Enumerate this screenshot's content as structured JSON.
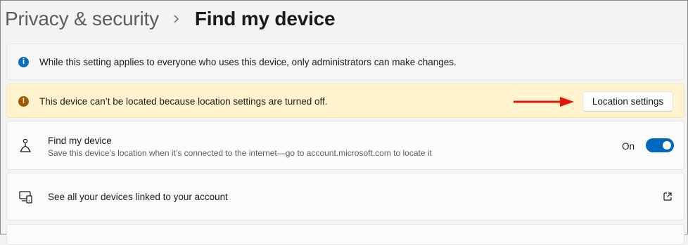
{
  "breadcrumb": {
    "parent": "Privacy & security",
    "separator_icon": "chevron-right-icon",
    "current": "Find my device"
  },
  "info_bar": {
    "icon": "info-icon",
    "message": "While this setting applies to everyone who uses this device, only administrators can make changes."
  },
  "warning_bar": {
    "icon": "warning-icon",
    "message": "This device can’t be located because location settings are turned off.",
    "button_label": "Location settings",
    "annotation": "red-arrow"
  },
  "find_my_device": {
    "icon": "find-device-icon",
    "title": "Find my device",
    "description": "Save this device’s location when it’s connected to the internet—go to account.microsoft.com to locate it",
    "toggle_state_label": "On",
    "toggle_on": true,
    "accent_color": "#0067c0"
  },
  "linked_devices": {
    "icon": "devices-icon",
    "title": "See all your devices linked to your account",
    "action_icon": "external-link-icon"
  }
}
